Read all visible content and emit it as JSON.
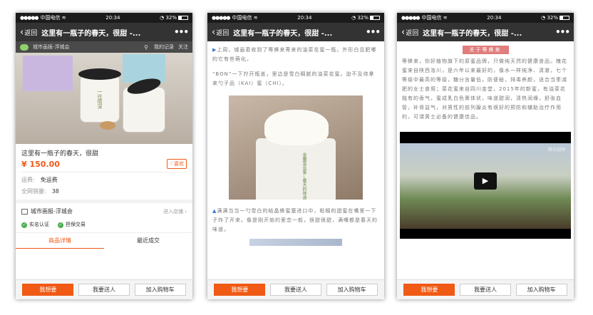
{
  "status": {
    "carrier": "中国电信",
    "time": "20:34",
    "battery": "32%"
  },
  "nav": {
    "back": "返回",
    "title": "这里有一瓶子的春天，很甜 -..."
  },
  "product": {
    "shop_name": "城市画报-浮城会",
    "my_records": "我的记录",
    "follow": "关注",
    "title": "这里有一瓶子的春天，很甜",
    "price": "¥ 150.00",
    "like": "喜欢",
    "shipping_label": "运费:",
    "shipping_value": "免运费",
    "sales_label": "全网销量:",
    "sales_value": "38",
    "enter_shop": "进入店铺",
    "badge_verified": "实名认证",
    "badge_secure": "担保交易",
    "tab_details": "商品详情",
    "tab_recent": "最近成交",
    "jar_text": "一往情深"
  },
  "article": {
    "p1": "上周，城画君收到了等蜂来寄来的油菜花蜜一瓶。外形白且肥嘟的它有些萌化。",
    "p2": "“BON”一下拧开瓶盖，里边是雪白稠腻的油菜花蜜。迫不及待拿来勺子品（KAI）蜜（CHI）。",
    "jar_label": "金馨菜花蜜—春天的味道",
    "p3": "满满当当一勺雪白的结晶蜂蜜塞进口中，粘稠的甜蜜在嘴里一下子炸了开来。像是刚开始的爱恋一般，很甜很甜，满嘴都是春天的味道。"
  },
  "brand": {
    "section_title": "关于等蜂来",
    "text": "等蜂来，你好植物旗下的原蜜品牌，只做纯天然的健康食品。槐花蜜来自陕西洛川，是六年以来最好的，像水一样纯净、清澈，七个等级中最高的等级，糖分含量低，防便秘，排毒养颜，适合当季减肥的女士食用；菜花蜜来自四川金堂，2015年的新蜜，有油菜花独有的香气，蜜成乳白色膏体状，味道甜润，清热润燥，舒张血管，补肾益气，对男性的前列腺炎有很好的预防和辅助治疗作用的，可谓男士必备的健康佳品。",
    "video_watermark": "腾讯视频"
  },
  "actions": {
    "want": "我想要",
    "gift": "我要送人",
    "cart": "加入购物车"
  }
}
